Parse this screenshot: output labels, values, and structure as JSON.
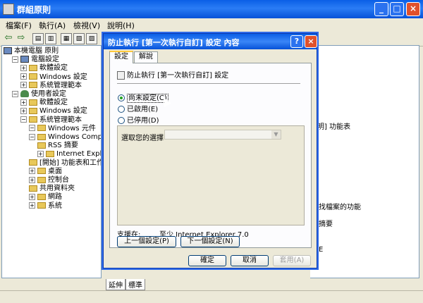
{
  "main_window": {
    "title": "群組原則",
    "menu": [
      "檔案(F)",
      "執行(A)",
      "檢視(V)",
      "說明(H)"
    ],
    "tree": [
      {
        "label": "本機電腦 原則",
        "indent": 0,
        "icon": "computer-icon"
      },
      {
        "label": "電腦設定",
        "indent": 1,
        "icon": "computer-icon",
        "exp": "−"
      },
      {
        "label": "軟體設定",
        "indent": 2,
        "icon": "folder-icon",
        "exp": "+"
      },
      {
        "label": "Windows 設定",
        "indent": 2,
        "icon": "folder-icon",
        "exp": "+"
      },
      {
        "label": "系統管理範本",
        "indent": 2,
        "icon": "folder-icon",
        "exp": "+"
      },
      {
        "label": "使用者設定",
        "indent": 1,
        "icon": "user-icon",
        "exp": "−"
      },
      {
        "label": "軟體設定",
        "indent": 2,
        "icon": "folder-icon",
        "exp": "+"
      },
      {
        "label": "Windows 設定",
        "indent": 2,
        "icon": "folder-icon",
        "exp": "+"
      },
      {
        "label": "系統管理範本",
        "indent": 2,
        "icon": "folder-icon",
        "exp": "−"
      },
      {
        "label": "Windows 元件",
        "indent": 3,
        "icon": "folder-icon",
        "exp": "−"
      },
      {
        "label": "Windows Components",
        "indent": 3,
        "icon": "folder-icon",
        "exp": "−"
      },
      {
        "label": "RSS 摘要",
        "indent": 4,
        "icon": "folder-icon"
      },
      {
        "label": "Internet Explorer",
        "indent": 4,
        "icon": "folder-icon",
        "exp": "+"
      },
      {
        "label": "[開始] 功能表和工作",
        "indent": 3,
        "icon": "folder-icon"
      },
      {
        "label": "桌面",
        "indent": 3,
        "icon": "folder-icon",
        "exp": "+"
      },
      {
        "label": "控制台",
        "indent": 3,
        "icon": "folder-icon",
        "exp": "+"
      },
      {
        "label": "共用資料夾",
        "indent": 3,
        "icon": "folder-icon"
      },
      {
        "label": "網路",
        "indent": 3,
        "icon": "folder-icon",
        "exp": "+"
      },
      {
        "label": "系統",
        "indent": 3,
        "icon": "folder-icon",
        "exp": "+"
      }
    ],
    "right_text": [
      "說明] 功能表",
      "找檔案的功能",
      "摘要",
      "E"
    ],
    "bottom_tabs": [
      "延伸",
      "標準"
    ]
  },
  "dialog": {
    "title": "防止執行 [第一次執行自訂] 設定 內容",
    "tabs": [
      "設定",
      "解說"
    ],
    "setting_name": "防止執行 [第一次執行自訂] 設定",
    "radios": [
      {
        "label": "尚未設定(C)",
        "checked": true
      },
      {
        "label": "已啟用(E)",
        "checked": false
      },
      {
        "label": "已停用(D)",
        "checked": false
      }
    ],
    "option_label": "選取您的選擇",
    "combo_value": "",
    "supported_label": "支援在:",
    "supported_value": "至少 Internet Explorer 7.0",
    "prev_button": "上一個設定(P)",
    "next_button": "下一個設定(N)",
    "ok_button": "確定",
    "cancel_button": "取消",
    "apply_button": "套用(A)"
  }
}
